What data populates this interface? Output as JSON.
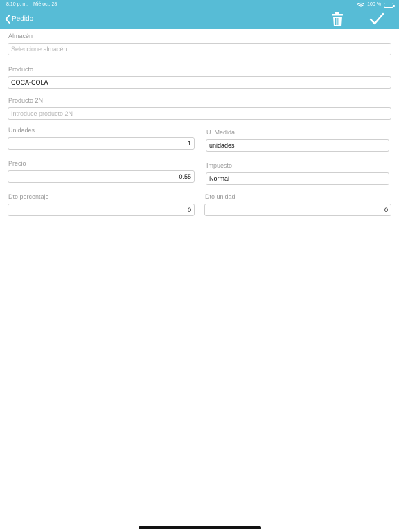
{
  "status_bar": {
    "time": "8:10 p. m.",
    "date": "Mié oct. 28",
    "battery": "100 %",
    "battery_level": 1.0
  },
  "nav": {
    "back_label": "Pedido"
  },
  "form": {
    "almacen": {
      "label": "Almacén",
      "placeholder": "Seleccione almacén",
      "value": ""
    },
    "producto": {
      "label": "Producto",
      "value": "COCA-COLA"
    },
    "producto_2n": {
      "label": "Producto 2N",
      "placeholder": "Introduce producto 2N",
      "value": ""
    },
    "unidades": {
      "label": "Unidades",
      "value": "1"
    },
    "u_medida": {
      "label": "U. Medida",
      "value": "unidades"
    },
    "precio": {
      "label": "Precio",
      "value": "0.55"
    },
    "impuesto": {
      "label": "Impuesto",
      "value": "Normal"
    },
    "dto_porcentaje": {
      "label": "Dto porcentaje",
      "value": "0"
    },
    "dto_unidad": {
      "label": "Dto unidad",
      "value": "0"
    }
  },
  "icons": {
    "back": "chevron-left-icon",
    "delete": "trash-icon",
    "confirm": "checkmark-icon",
    "wifi": "wifi-icon",
    "battery": "battery-icon"
  },
  "colors": {
    "accent": "#57bcd6",
    "label": "#9a9a9a",
    "border": "#cfcfcf",
    "placeholder": "#b5b5b5"
  }
}
